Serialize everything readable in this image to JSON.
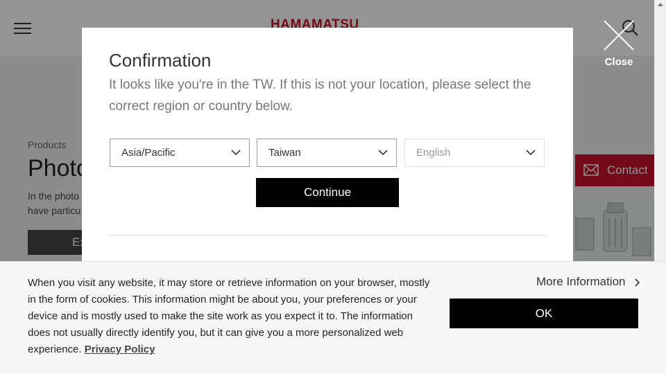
{
  "header": {
    "logo_text": "HAMAMATSU"
  },
  "page": {
    "breadcrumb": "Products",
    "heading": "Photo",
    "description": "In the photo\nhave particu",
    "explore_button": "Ex",
    "contact_tab": "Contact"
  },
  "overlay": {
    "close_label": "Close"
  },
  "modal": {
    "title": "Confirmation",
    "message": "It looks like you're in the TW. If this is not your location, please select the correct region or country below.",
    "region_value": "Asia/Pacific",
    "country_value": "Taiwan",
    "language_value": "English",
    "continue_label": "Continue"
  },
  "cookie_banner": {
    "text": "When you visit any website, it may store or retrieve information on your browser, mostly in the form of cookies. This information might be about you, your preferences or your device and is mostly used to make the site work as you expect it to. The information does not usually directly identify you, but it can give you a more personalized web experience.",
    "privacy_link": "Privacy Policy",
    "more_info": "More Information",
    "ok_label": "OK"
  },
  "colors": {
    "brand_red": "#c8102e",
    "button_black": "#000000",
    "overlay": "rgba(0,0,0,0.42)"
  },
  "icons": [
    "hamburger-icon",
    "search-icon",
    "close-icon",
    "mail-icon",
    "chevron-down-icon",
    "chevron-right-icon"
  ]
}
